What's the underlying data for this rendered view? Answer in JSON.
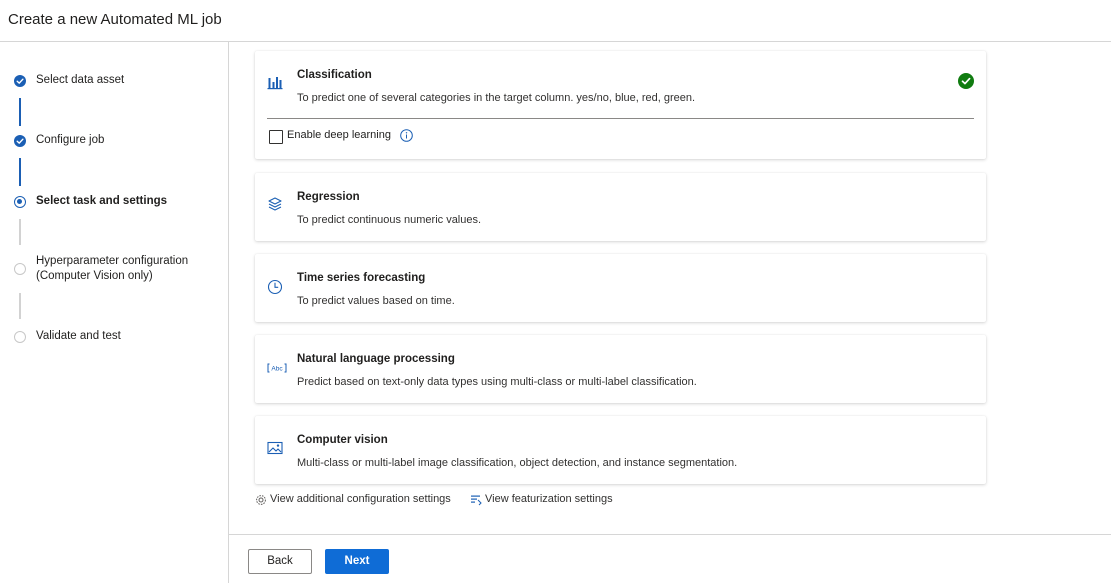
{
  "header": {
    "title": "Create a new Automated ML job"
  },
  "stepper": {
    "steps": [
      {
        "label": "Select data asset",
        "state": "done"
      },
      {
        "label": "Configure job",
        "state": "done"
      },
      {
        "label": "Select task and settings",
        "state": "current"
      },
      {
        "label_line1": "Hyperparameter configuration",
        "label_line2": "(Computer Vision only)",
        "state": "todo"
      },
      {
        "label": "Validate and test",
        "state": "todo"
      }
    ]
  },
  "tasks": [
    {
      "title": "Classification",
      "description": "To predict one of several categories in the target column. yes/no, blue, red, green.",
      "icon": "bar-chart-icon",
      "selected": true,
      "option": {
        "label": "Enable deep learning",
        "checked": false
      }
    },
    {
      "title": "Regression",
      "description": "To predict continuous numeric values.",
      "icon": "layers-icon",
      "selected": false
    },
    {
      "title": "Time series forecasting",
      "description": "To predict values based on time.",
      "icon": "clock-icon",
      "selected": false
    },
    {
      "title": "Natural language processing",
      "description": "Predict based on text-only data types using multi-class or multi-label classification.",
      "icon": "text-abc-icon",
      "selected": false
    },
    {
      "title": "Computer vision",
      "description": "Multi-class or multi-label image classification, object detection, and instance segmentation.",
      "icon": "image-icon",
      "selected": false
    }
  ],
  "links": {
    "additional_config": "View additional configuration settings",
    "featurization": "View featurization settings"
  },
  "footer": {
    "back_label": "Back",
    "next_label": "Next"
  },
  "colors": {
    "accent": "#0f6cd6",
    "step": "#1b5fb4",
    "success": "#107c10"
  }
}
